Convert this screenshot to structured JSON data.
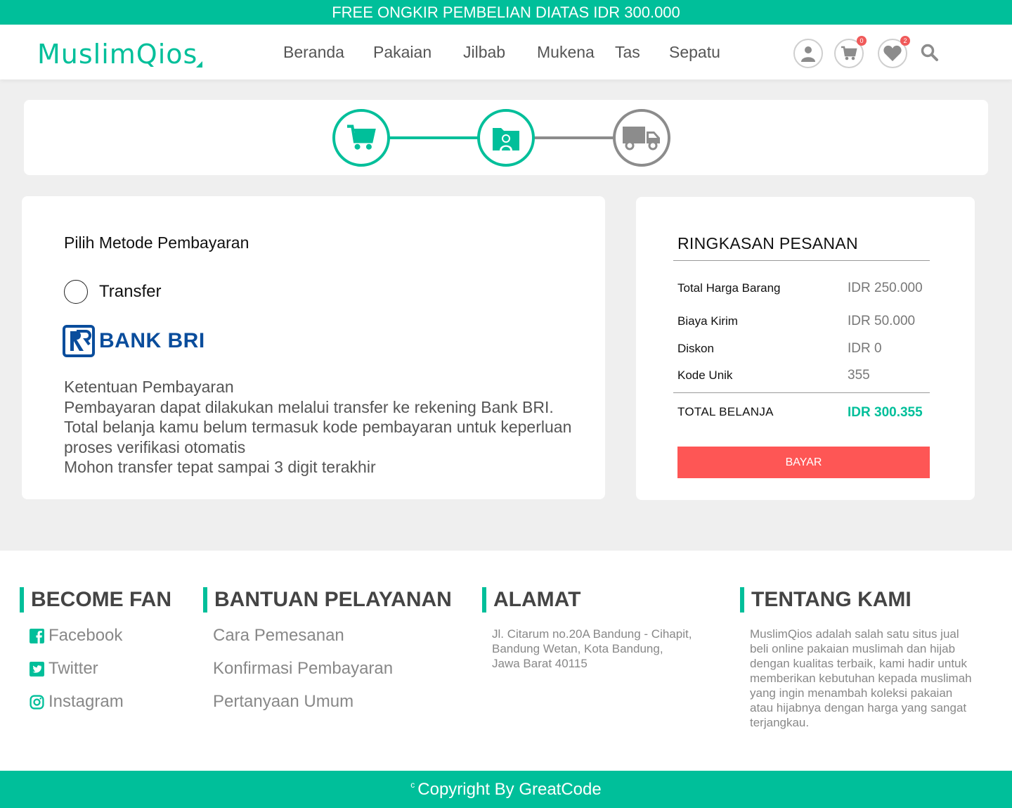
{
  "promo_text": "FREE ONGKIR PEMBELIAN DIATAS IDR 300.000",
  "brand": {
    "logo_text": "MuslimQios",
    "color": "#00bf9a"
  },
  "nav": {
    "items": [
      {
        "label": "Beranda"
      },
      {
        "label": "Pakaian"
      },
      {
        "label": "Jilbab"
      },
      {
        "label": "Mukena"
      },
      {
        "label": "Tas"
      },
      {
        "label": "Sepatu"
      }
    ],
    "icons": {
      "user": "user-icon",
      "cart": "cart-icon",
      "cart_count": "0",
      "wishlist": "heart-icon",
      "wishlist_count": "2",
      "search": "search-icon"
    }
  },
  "steps": [
    {
      "icon": "cart-icon",
      "state": "done"
    },
    {
      "icon": "payment-folder-icon",
      "state": "active"
    },
    {
      "icon": "truck-icon",
      "state": "pending"
    }
  ],
  "payment": {
    "title": "Pilih Metode Pembayaran",
    "option_label": "Transfer",
    "bank_name": "BANK BRI",
    "terms": [
      "Ketentuan Pembayaran",
      "Pembayaran dapat dilakukan melalui transfer ke rekening Bank BRI.",
      "Total belanja kamu belum termasuk kode pembayaran untuk keperluan proses verifikasi otomatis",
      "Mohon transfer tepat sampai 3 digit terakhir"
    ]
  },
  "summary": {
    "title": "RINGKASAN PESANAN",
    "rows": [
      {
        "label": "Total Harga Barang",
        "value": "IDR 250.000"
      },
      {
        "label": "Biaya Kirim",
        "value": "IDR 50.000"
      },
      {
        "label": "Diskon",
        "value": "IDR 0"
      },
      {
        "label": "Kode Unik",
        "value": "355"
      }
    ],
    "total_label": "TOTAL BELANJA",
    "total_value": "IDR 300.355",
    "pay_button": "BAYAR",
    "accent": "#fe5655"
  },
  "footer": {
    "fan": {
      "title": "BECOME FAN",
      "links": [
        "Facebook",
        "Twitter",
        "Instagram"
      ]
    },
    "service": {
      "title": "BANTUAN PELAYANAN",
      "links": [
        "Cara Pemesanan",
        "Konfirmasi Pembayaran",
        "Pertanyaan Umum"
      ]
    },
    "address": {
      "title": "ALAMAT",
      "lines": [
        "Jl. Citarum no.20A Bandung - Cihapit,",
        "Bandung Wetan, Kota Bandung,",
        "Jawa Barat 40115"
      ]
    },
    "about": {
      "title": "TENTANG KAMI",
      "lines": [
        "MuslimQios adalah salah satu situs jual",
        "beli online pakaian muslimah dan hijab",
        "dengan kualitas terbaik, kami hadir untuk",
        "memberikan kebutuhan kepada muslimah",
        "yang ingin menambah koleksi pakaian",
        "atau hijabnya dengan harga yang sangat",
        "terjangkau."
      ]
    }
  },
  "copyright": {
    "mark": "c",
    "text": "Copyright By GreatCode"
  }
}
